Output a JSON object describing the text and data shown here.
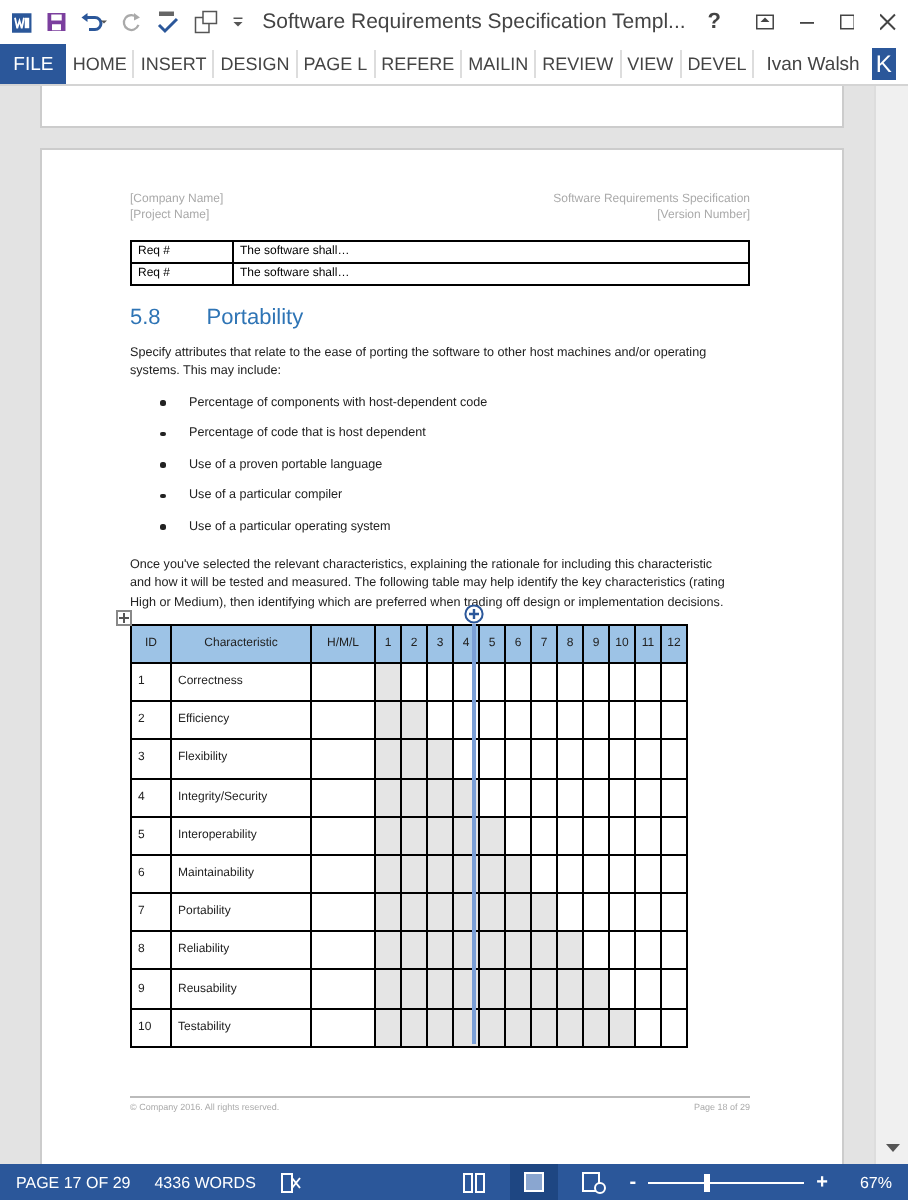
{
  "window": {
    "title": "Software Requirements Specification Templ...",
    "help": "?"
  },
  "ribbon": {
    "file": "FILE",
    "tabs": [
      "HOME",
      "INSERT",
      "DESIGN",
      "PAGE L",
      "REFERE",
      "MAILIN",
      "REVIEW",
      "VIEW",
      "DEVEL"
    ],
    "user": "Ivan Walsh",
    "avatar": "K"
  },
  "page": {
    "header": {
      "left": [
        "[Company Name]",
        "[Project Name]"
      ],
      "right": [
        "Software Requirements Specification",
        "[Version Number]"
      ]
    },
    "req_table": [
      [
        "Req #",
        "The software shall…"
      ],
      [
        "Req #",
        "The software shall…"
      ]
    ],
    "heading": {
      "number": "5.8",
      "title": "Portability"
    },
    "intro": "Specify attributes that relate to the ease of porting the software to other host machines and/or operating systems. This may include:",
    "bullets": [
      "Percentage of components with host-dependent code",
      "Percentage of code that is host dependent",
      "Use of a proven portable language",
      "Use of a particular compiler",
      "Use of a particular operating system"
    ],
    "body": "Once you've selected the relevant characteristics, explaining the rationale for including this characteristic and how it will be tested and measured. The following table may help identify the key characteristics (rating High or Medium), then identifying which are preferred when trading off design or implementation decisions.",
    "table": {
      "columns": [
        "ID",
        "Characteristic",
        "H/M/L",
        "1",
        "2",
        "3",
        "4",
        "5",
        "6",
        "7",
        "8",
        "9",
        "10",
        "11",
        "12"
      ],
      "rows": [
        {
          "id": "1",
          "name": "Correctness",
          "shaded": [
            true,
            false,
            false,
            false,
            false,
            false,
            false,
            false,
            false,
            false,
            false,
            false
          ]
        },
        {
          "id": "2",
          "name": "Efficiency",
          "shaded": [
            true,
            true,
            false,
            false,
            false,
            false,
            false,
            false,
            false,
            false,
            false,
            false
          ]
        },
        {
          "id": "3",
          "name": "Flexibility",
          "shaded": [
            true,
            true,
            true,
            false,
            false,
            false,
            false,
            false,
            false,
            false,
            false,
            false
          ]
        },
        {
          "id": "4",
          "name": "Integrity/Security",
          "shaded": [
            true,
            true,
            true,
            true,
            false,
            false,
            false,
            false,
            false,
            false,
            false,
            false
          ]
        },
        {
          "id": "5",
          "name": "Interoperability",
          "shaded": [
            true,
            true,
            true,
            true,
            true,
            false,
            false,
            false,
            false,
            false,
            false,
            false
          ]
        },
        {
          "id": "6",
          "name": "Maintainability",
          "shaded": [
            true,
            true,
            true,
            true,
            true,
            true,
            false,
            false,
            false,
            false,
            false,
            false
          ]
        },
        {
          "id": "7",
          "name": "Portability",
          "shaded": [
            true,
            true,
            true,
            true,
            true,
            true,
            true,
            false,
            false,
            false,
            false,
            false
          ]
        },
        {
          "id": "8",
          "name": "Reliability",
          "shaded": [
            true,
            true,
            true,
            true,
            true,
            true,
            true,
            true,
            false,
            false,
            false,
            false
          ]
        },
        {
          "id": "9",
          "name": "Reusability",
          "shaded": [
            true,
            true,
            true,
            true,
            true,
            true,
            true,
            true,
            true,
            false,
            false,
            false
          ]
        },
        {
          "id": "10",
          "name": "Testability",
          "shaded": [
            true,
            true,
            true,
            true,
            true,
            true,
            true,
            true,
            true,
            true,
            false,
            false
          ]
        }
      ]
    },
    "footer": {
      "left": "© Company 2016. All rights reserved.",
      "right": "Page 18 of 29"
    }
  },
  "status_bar": {
    "page": "PAGE 17 OF 29",
    "words": "4336 WORDS",
    "zoom": {
      "level": 0.37
    },
    "zoom_minus": "-",
    "zoom_plus": "+",
    "zoom_percent": "67%"
  }
}
